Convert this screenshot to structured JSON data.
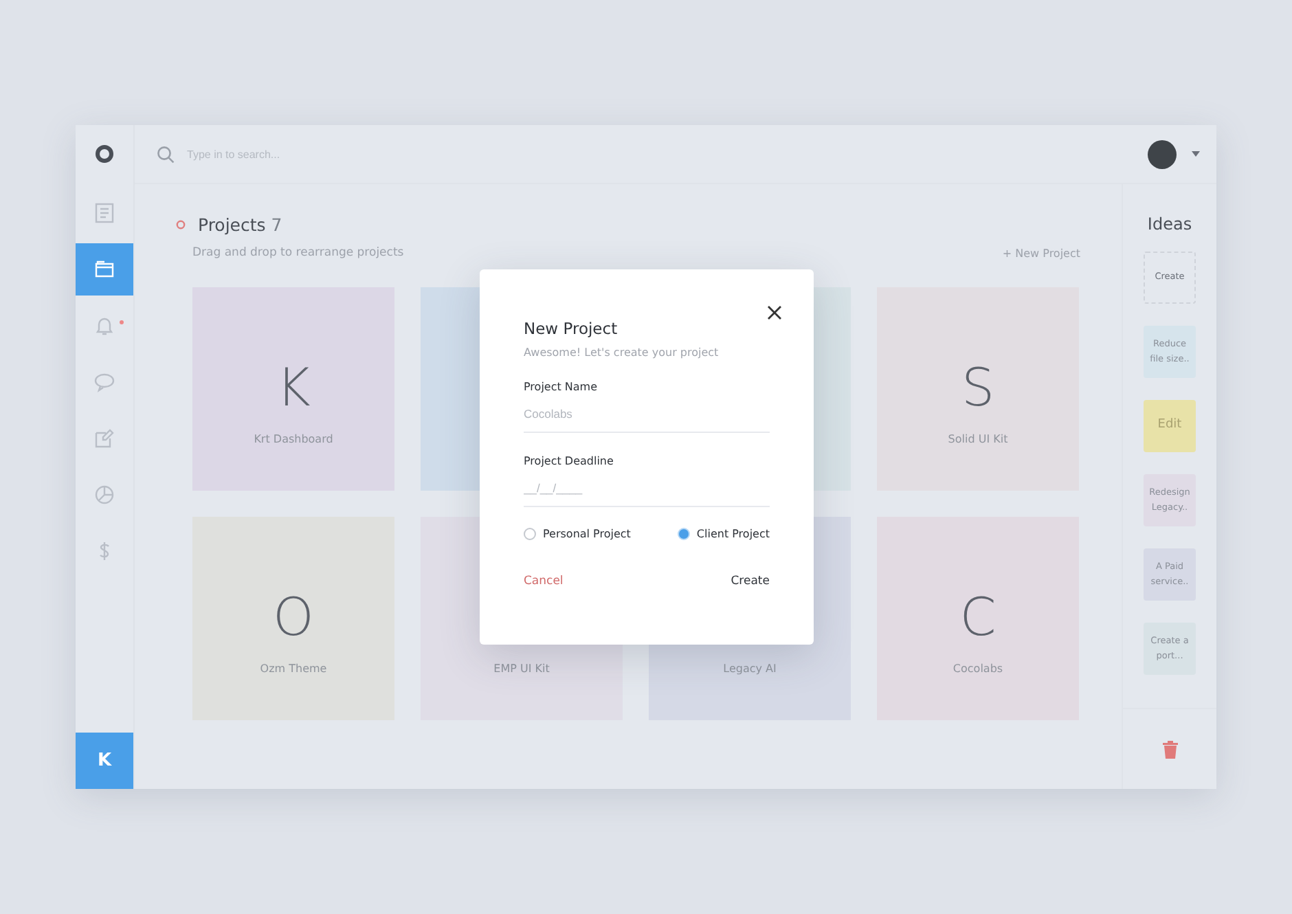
{
  "sidebar": {
    "items": [
      {
        "selected": false,
        "dot": false
      },
      {
        "selected": true,
        "dot": false
      },
      {
        "selected": false,
        "dot": true
      },
      {
        "selected": false,
        "dot": false
      },
      {
        "selected": false,
        "dot": false
      },
      {
        "selected": false,
        "dot": false
      },
      {
        "selected": false,
        "dot": false
      }
    ],
    "user_initial": "K"
  },
  "search": {
    "placeholder": "Type in to search..."
  },
  "projects": {
    "title": "Projects",
    "count": "7",
    "subtitle": "Drag and drop to rearrange projects",
    "new_link": "+ New Project",
    "cards": [
      {
        "letter": "K",
        "name": "Krt Dashboard",
        "color": "#dcd7e6"
      },
      {
        "color": "#cfdcea"
      },
      {
        "color": "#d7e2e6"
      },
      {
        "letter": "S",
        "name": "Solid UI Kit",
        "color": "#e2dde2"
      },
      {
        "letter": "O",
        "name": "Ozm Theme",
        "color": "#dfe0dd"
      },
      {
        "name": "EMP UI Kit",
        "color": "#e0dde7"
      },
      {
        "name": "Legacy AI",
        "color": "#d5d9e6"
      },
      {
        "letter": "C",
        "name": "Cocolabs",
        "color": "#e2dae2"
      }
    ]
  },
  "ideas": {
    "title": "Ideas",
    "items": [
      {
        "kind": "dashed",
        "text": "Create"
      },
      {
        "kind": "note",
        "text": "Reduce file size..",
        "color": "#d6e4ec"
      },
      {
        "kind": "big",
        "text": "Edit",
        "color": "#e8e2a8"
      },
      {
        "kind": "note",
        "text": "Redesign Legacy..",
        "color": "#e0dbe6"
      },
      {
        "kind": "note",
        "text": "A Paid service..",
        "color": "#d6d9e6"
      },
      {
        "kind": "note",
        "text": "Create a port...",
        "color": "#d8e2e6"
      }
    ]
  },
  "modal": {
    "title": "New Project",
    "subtitle": "Awesome! Let's create your project",
    "fields": [
      {
        "label": "Project Name",
        "placeholder": "Cocolabs"
      },
      {
        "label": "Project Deadline",
        "placeholder": "__/__/____"
      }
    ],
    "options": [
      {
        "label": "Personal Project",
        "selected": false
      },
      {
        "label": "Client Project",
        "selected": true
      }
    ],
    "cancel": "Cancel",
    "create": "Create"
  }
}
